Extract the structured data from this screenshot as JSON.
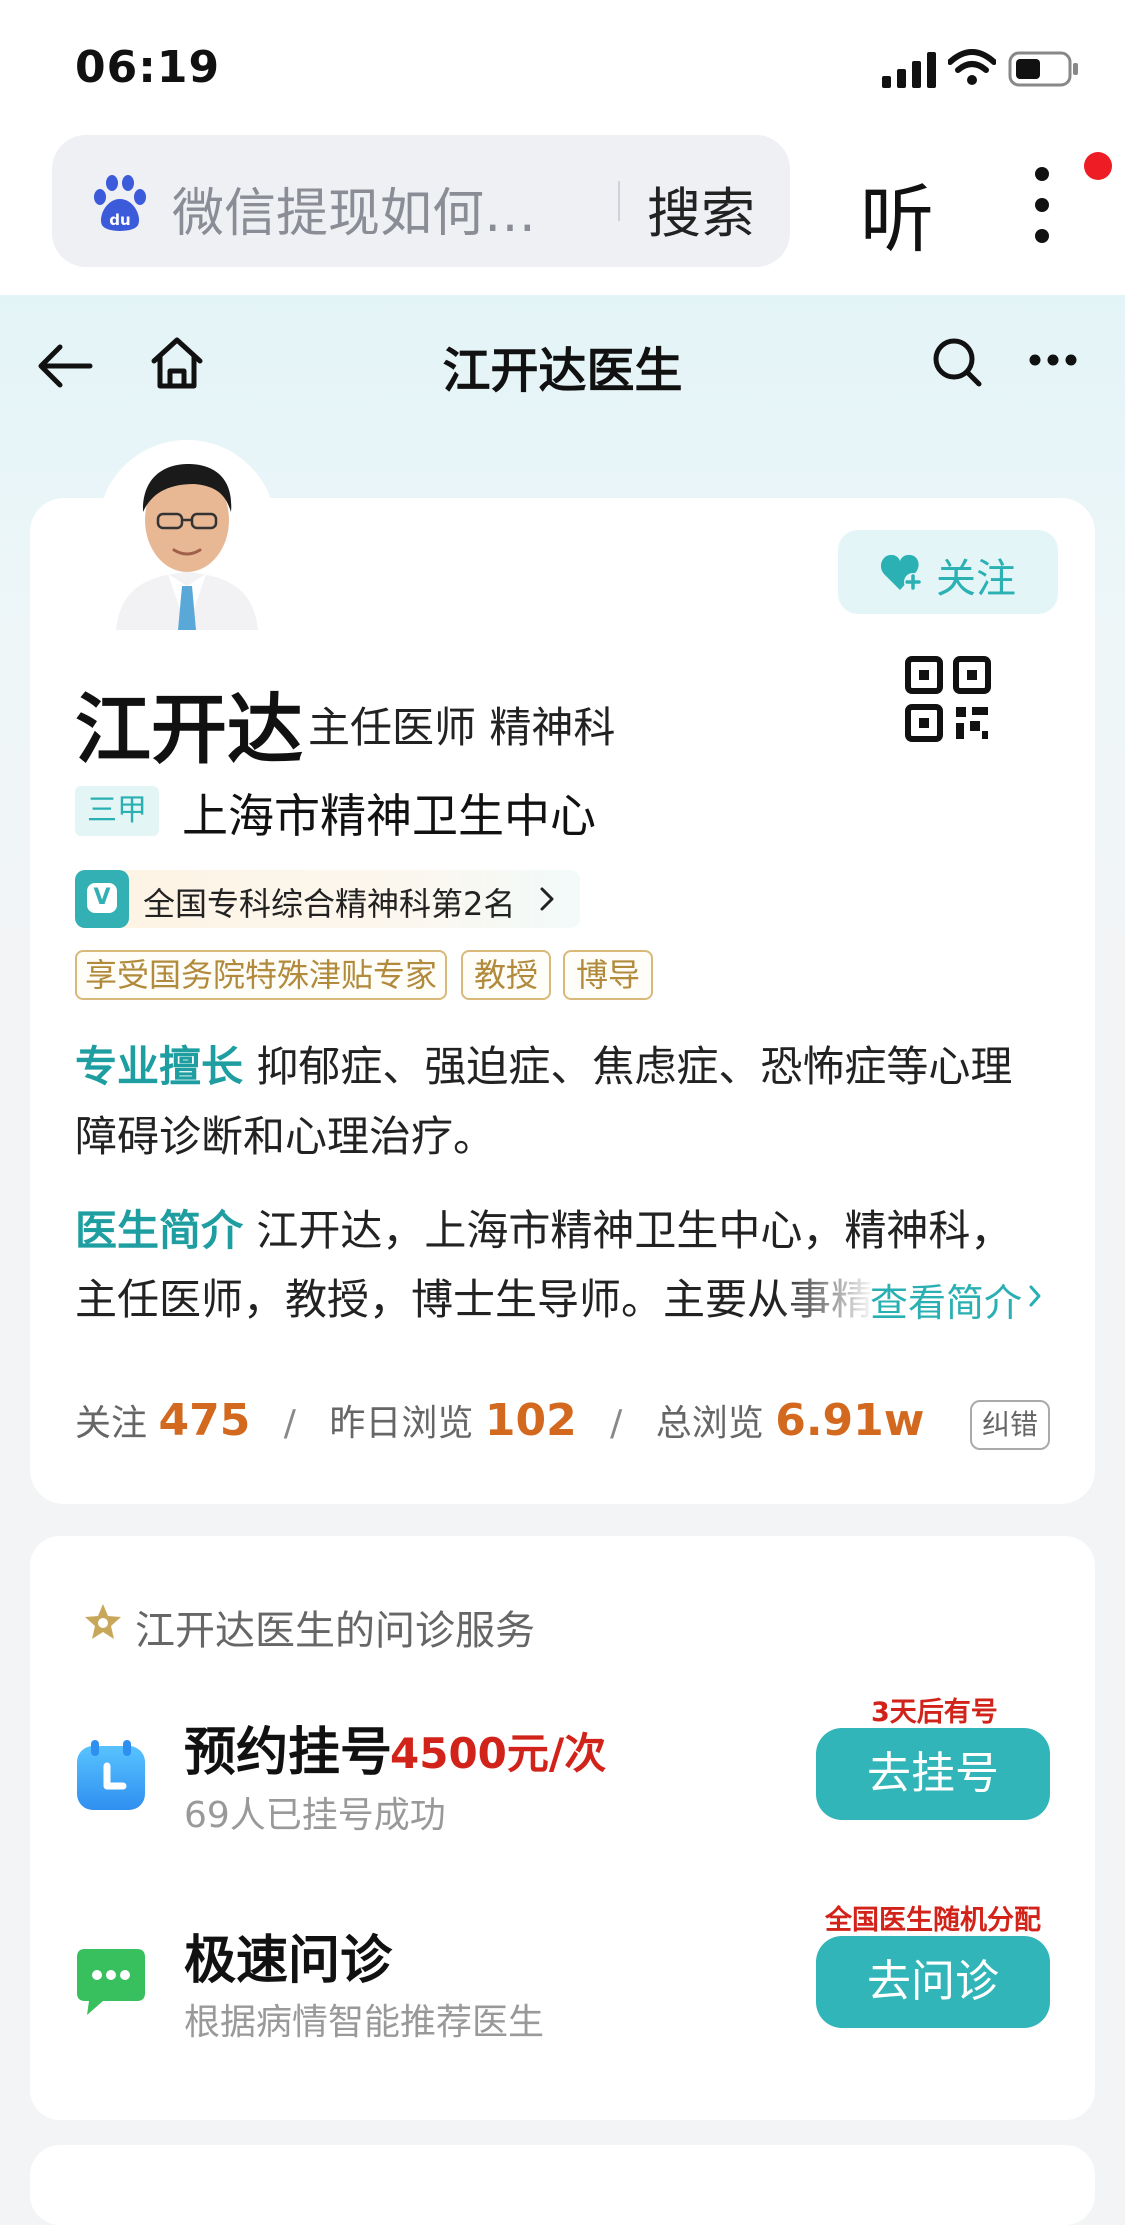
{
  "status_bar": {
    "time": "06:19"
  },
  "browser": {
    "address_text": "微信提现如何…",
    "search_label": "搜索",
    "listen_label": "听"
  },
  "nav": {
    "title": "江开达医生"
  },
  "profile": {
    "follow_label": "关注",
    "name": "江开达",
    "title": "主任医师  精神科",
    "hospital_level": "三甲",
    "hospital": "上海市精神卫生中心",
    "rank_badge": "V",
    "rank_text": "全国专科综合精神科第2名",
    "tags": [
      "享受国务院特殊津贴专家",
      "教授",
      "博导"
    ],
    "specialty_label": "专业擅长",
    "specialty_text": "抑郁症、强迫症、焦虑症、恐怖症等心理障碍诊断和心理治疗。",
    "intro_label": "医生简介",
    "intro_line1": "江开达，上海市精神卫生中心，精神科，",
    "intro_line2": "主任医师，教授，博士生导师。主要从事精",
    "view_intro_label": "查看简介",
    "stats": {
      "follow_label": "关注",
      "follow_value": "475",
      "yesterday_label": "昨日浏览",
      "yesterday_value": "102",
      "total_label": "总浏览",
      "total_value": "6.91w",
      "separator": "/"
    },
    "correct_label": "纠错"
  },
  "services": {
    "title": "江开达医生的问诊服务",
    "items": [
      {
        "name": "预约挂号",
        "price": "4500元/次",
        "sub": "69人已挂号成功",
        "note": "3天后有号",
        "button": "去挂号",
        "icon": "calendar-clock-icon"
      },
      {
        "name": "极速问诊",
        "price": "",
        "sub": "根据病情智能推荐医生",
        "note": "全国医生随机分配",
        "button": "去问诊",
        "icon": "chat-bubble-icon"
      }
    ]
  },
  "colors": {
    "accent": "#31b5b8",
    "price_red": "#d2231a",
    "stat_orange": "#d2691e",
    "tag_gold": "#b18a3c"
  }
}
